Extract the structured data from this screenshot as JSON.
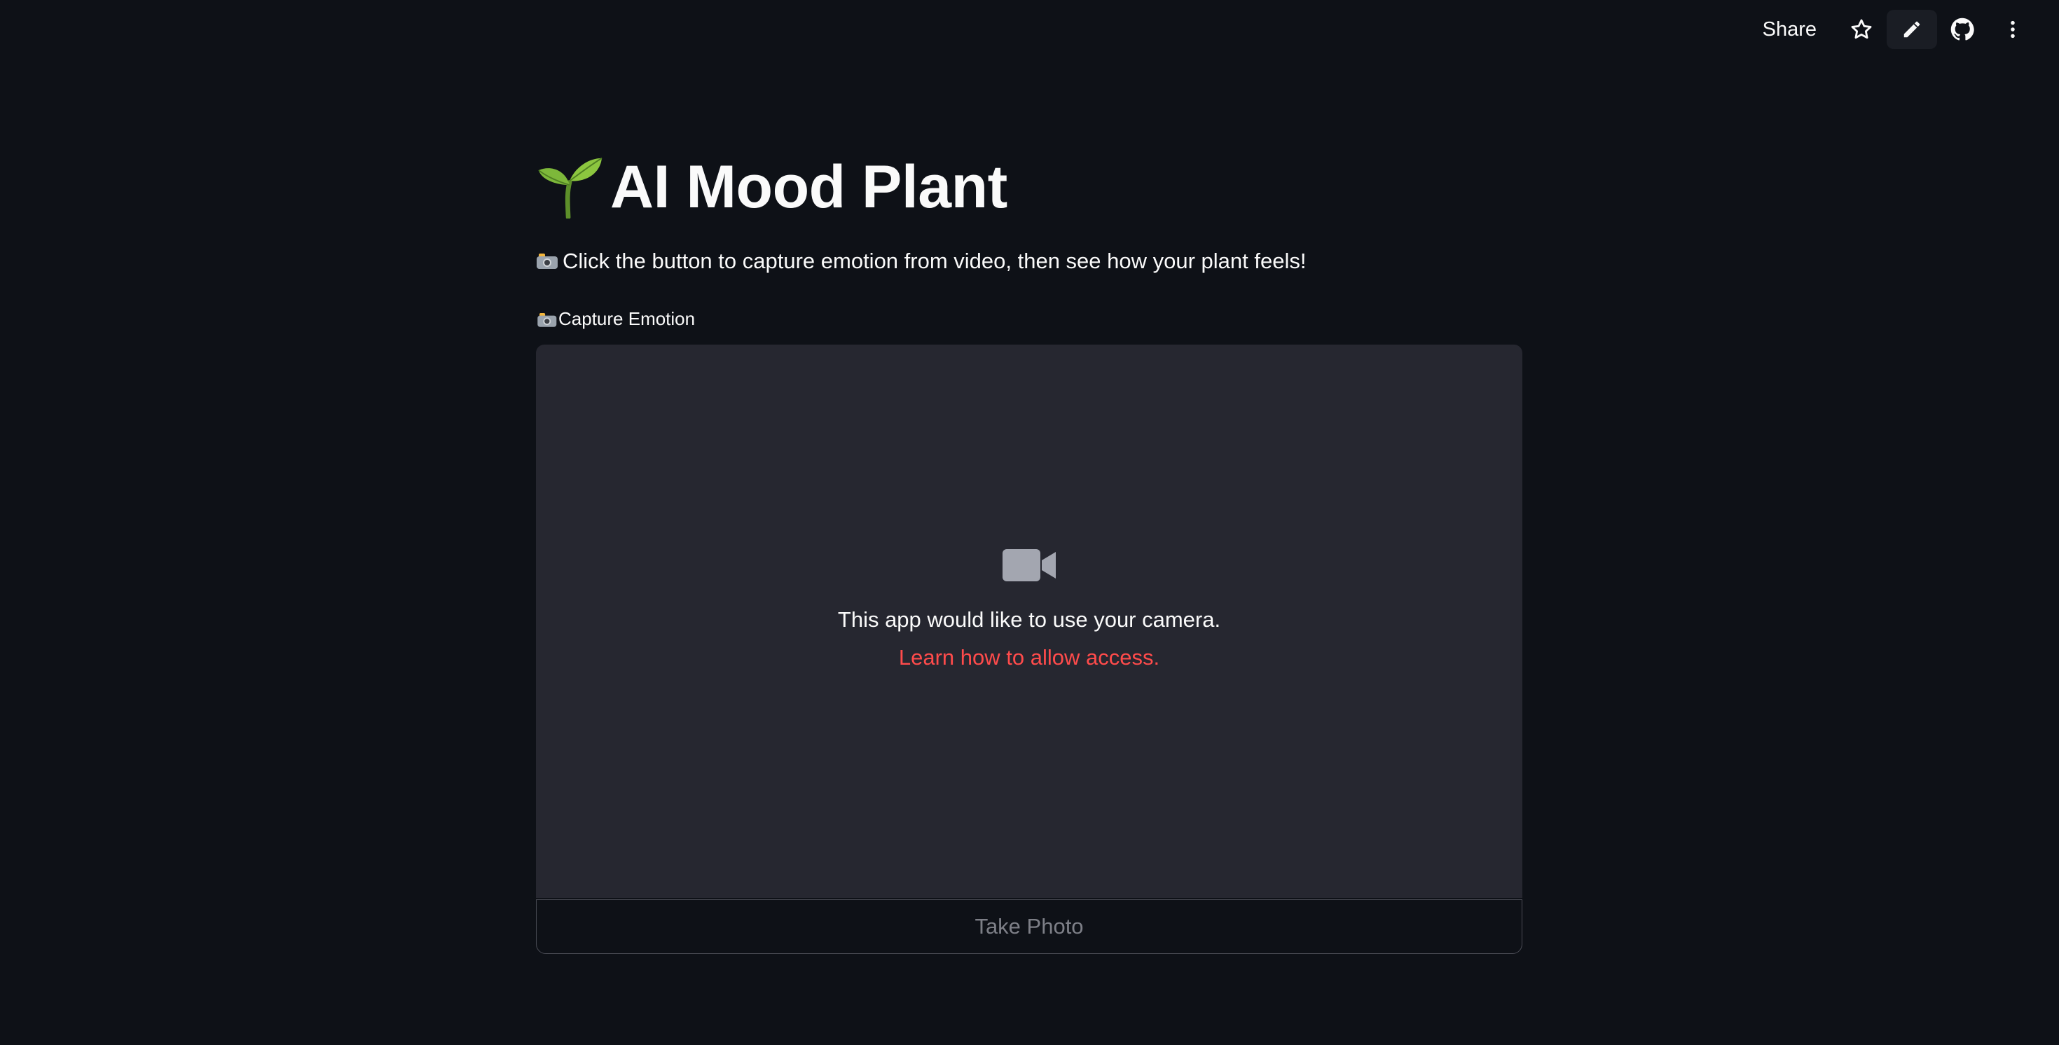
{
  "toolbar": {
    "share_label": "Share",
    "icons": [
      "star-icon",
      "pencil-icon",
      "github-icon",
      "kebab-menu-icon"
    ]
  },
  "header": {
    "title_emoji": "sprout",
    "title": "AI Mood Plant"
  },
  "intro": {
    "text": "Click the button to capture emotion from video, then see how your plant feels!"
  },
  "camera_input": {
    "label": "Capture Emotion",
    "message": "This app would like to use your camera.",
    "link_text": "Learn how to allow access.",
    "button_label": "Take Photo"
  },
  "colors": {
    "background": "#0e1117",
    "panel": "#262730",
    "accent_link": "#ff4b4b",
    "text": "#fafafa",
    "muted": "#7d7f87"
  }
}
